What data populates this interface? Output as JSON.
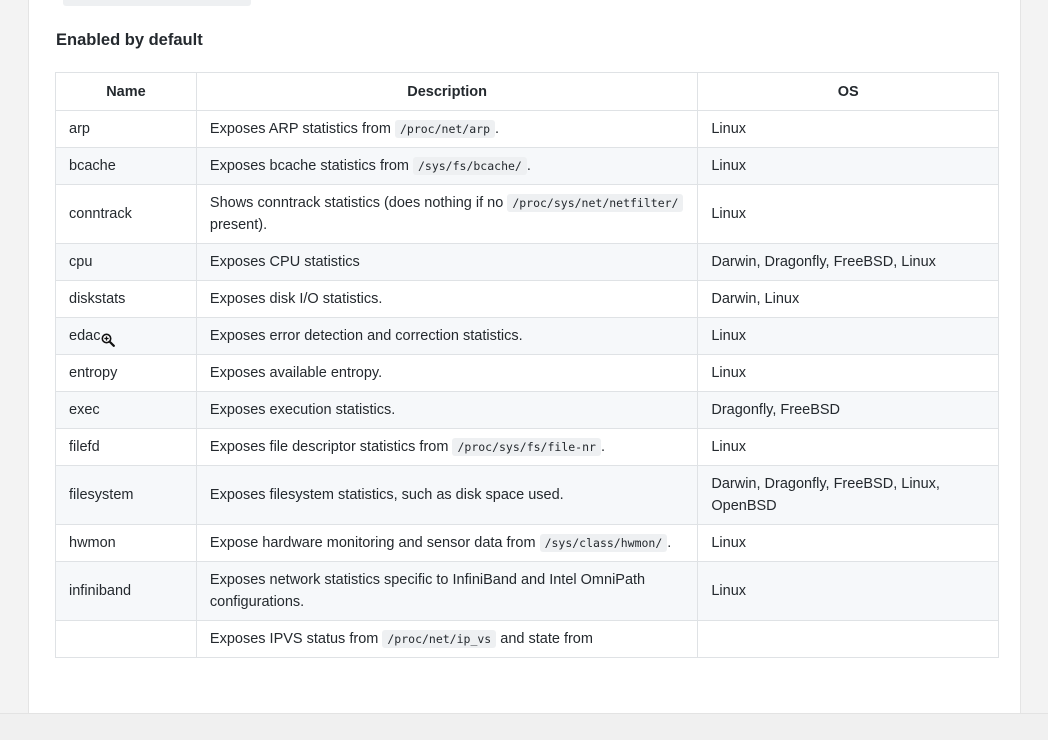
{
  "section_title": "Enabled by default",
  "table": {
    "headers": [
      "Name",
      "Description",
      "OS"
    ],
    "rows": [
      {
        "name": "arp",
        "desc_pre": "Exposes ARP statistics from ",
        "desc_code": "/proc/net/arp",
        "desc_post": ".",
        "os": "Linux"
      },
      {
        "name": "bcache",
        "desc_pre": "Exposes bcache statistics from ",
        "desc_code": "/sys/fs/bcache/",
        "desc_post": ".",
        "os": "Linux"
      },
      {
        "name": "conntrack",
        "desc_pre": "Shows conntrack statistics (does nothing if no ",
        "desc_code": "/proc/sys/net/netfilter/",
        "desc_post": " present).",
        "os": "Linux"
      },
      {
        "name": "cpu",
        "desc_pre": "Exposes CPU statistics",
        "desc_code": "",
        "desc_post": "",
        "os": "Darwin, Dragonfly, FreeBSD, Linux"
      },
      {
        "name": "diskstats",
        "desc_pre": "Exposes disk I/O statistics.",
        "desc_code": "",
        "desc_post": "",
        "os": "Darwin, Linux"
      },
      {
        "name": "edac",
        "desc_pre": "Exposes error detection and correction statistics.",
        "desc_code": "",
        "desc_post": "",
        "os": "Linux"
      },
      {
        "name": "entropy",
        "desc_pre": "Exposes available entropy.",
        "desc_code": "",
        "desc_post": "",
        "os": "Linux"
      },
      {
        "name": "exec",
        "desc_pre": "Exposes execution statistics.",
        "desc_code": "",
        "desc_post": "",
        "os": "Dragonfly, FreeBSD"
      },
      {
        "name": "filefd",
        "desc_pre": "Exposes file descriptor statistics from ",
        "desc_code": "/proc/sys/fs/file-nr",
        "desc_post": ".",
        "os": "Linux"
      },
      {
        "name": "filesystem",
        "desc_pre": "Exposes filesystem statistics, such as disk space used.",
        "desc_code": "",
        "desc_post": "",
        "os": "Darwin, Dragonfly, FreeBSD, Linux, OpenBSD"
      },
      {
        "name": "hwmon",
        "desc_pre": "Expose hardware monitoring and sensor data from ",
        "desc_code": "/sys/class/hwmon/",
        "desc_post": ".",
        "os": "Linux"
      },
      {
        "name": "infiniband",
        "desc_pre": "Exposes network statistics specific to InfiniBand and Intel OmniPath configurations.",
        "desc_code": "",
        "desc_post": "",
        "os": "Linux"
      },
      {
        "name": "",
        "desc_pre": "Exposes IPVS status from ",
        "desc_code": "/proc/net/ip_vs",
        "desc_post": " and state from",
        "os": ""
      }
    ]
  },
  "cursor_icon": "zoom-in-icon"
}
